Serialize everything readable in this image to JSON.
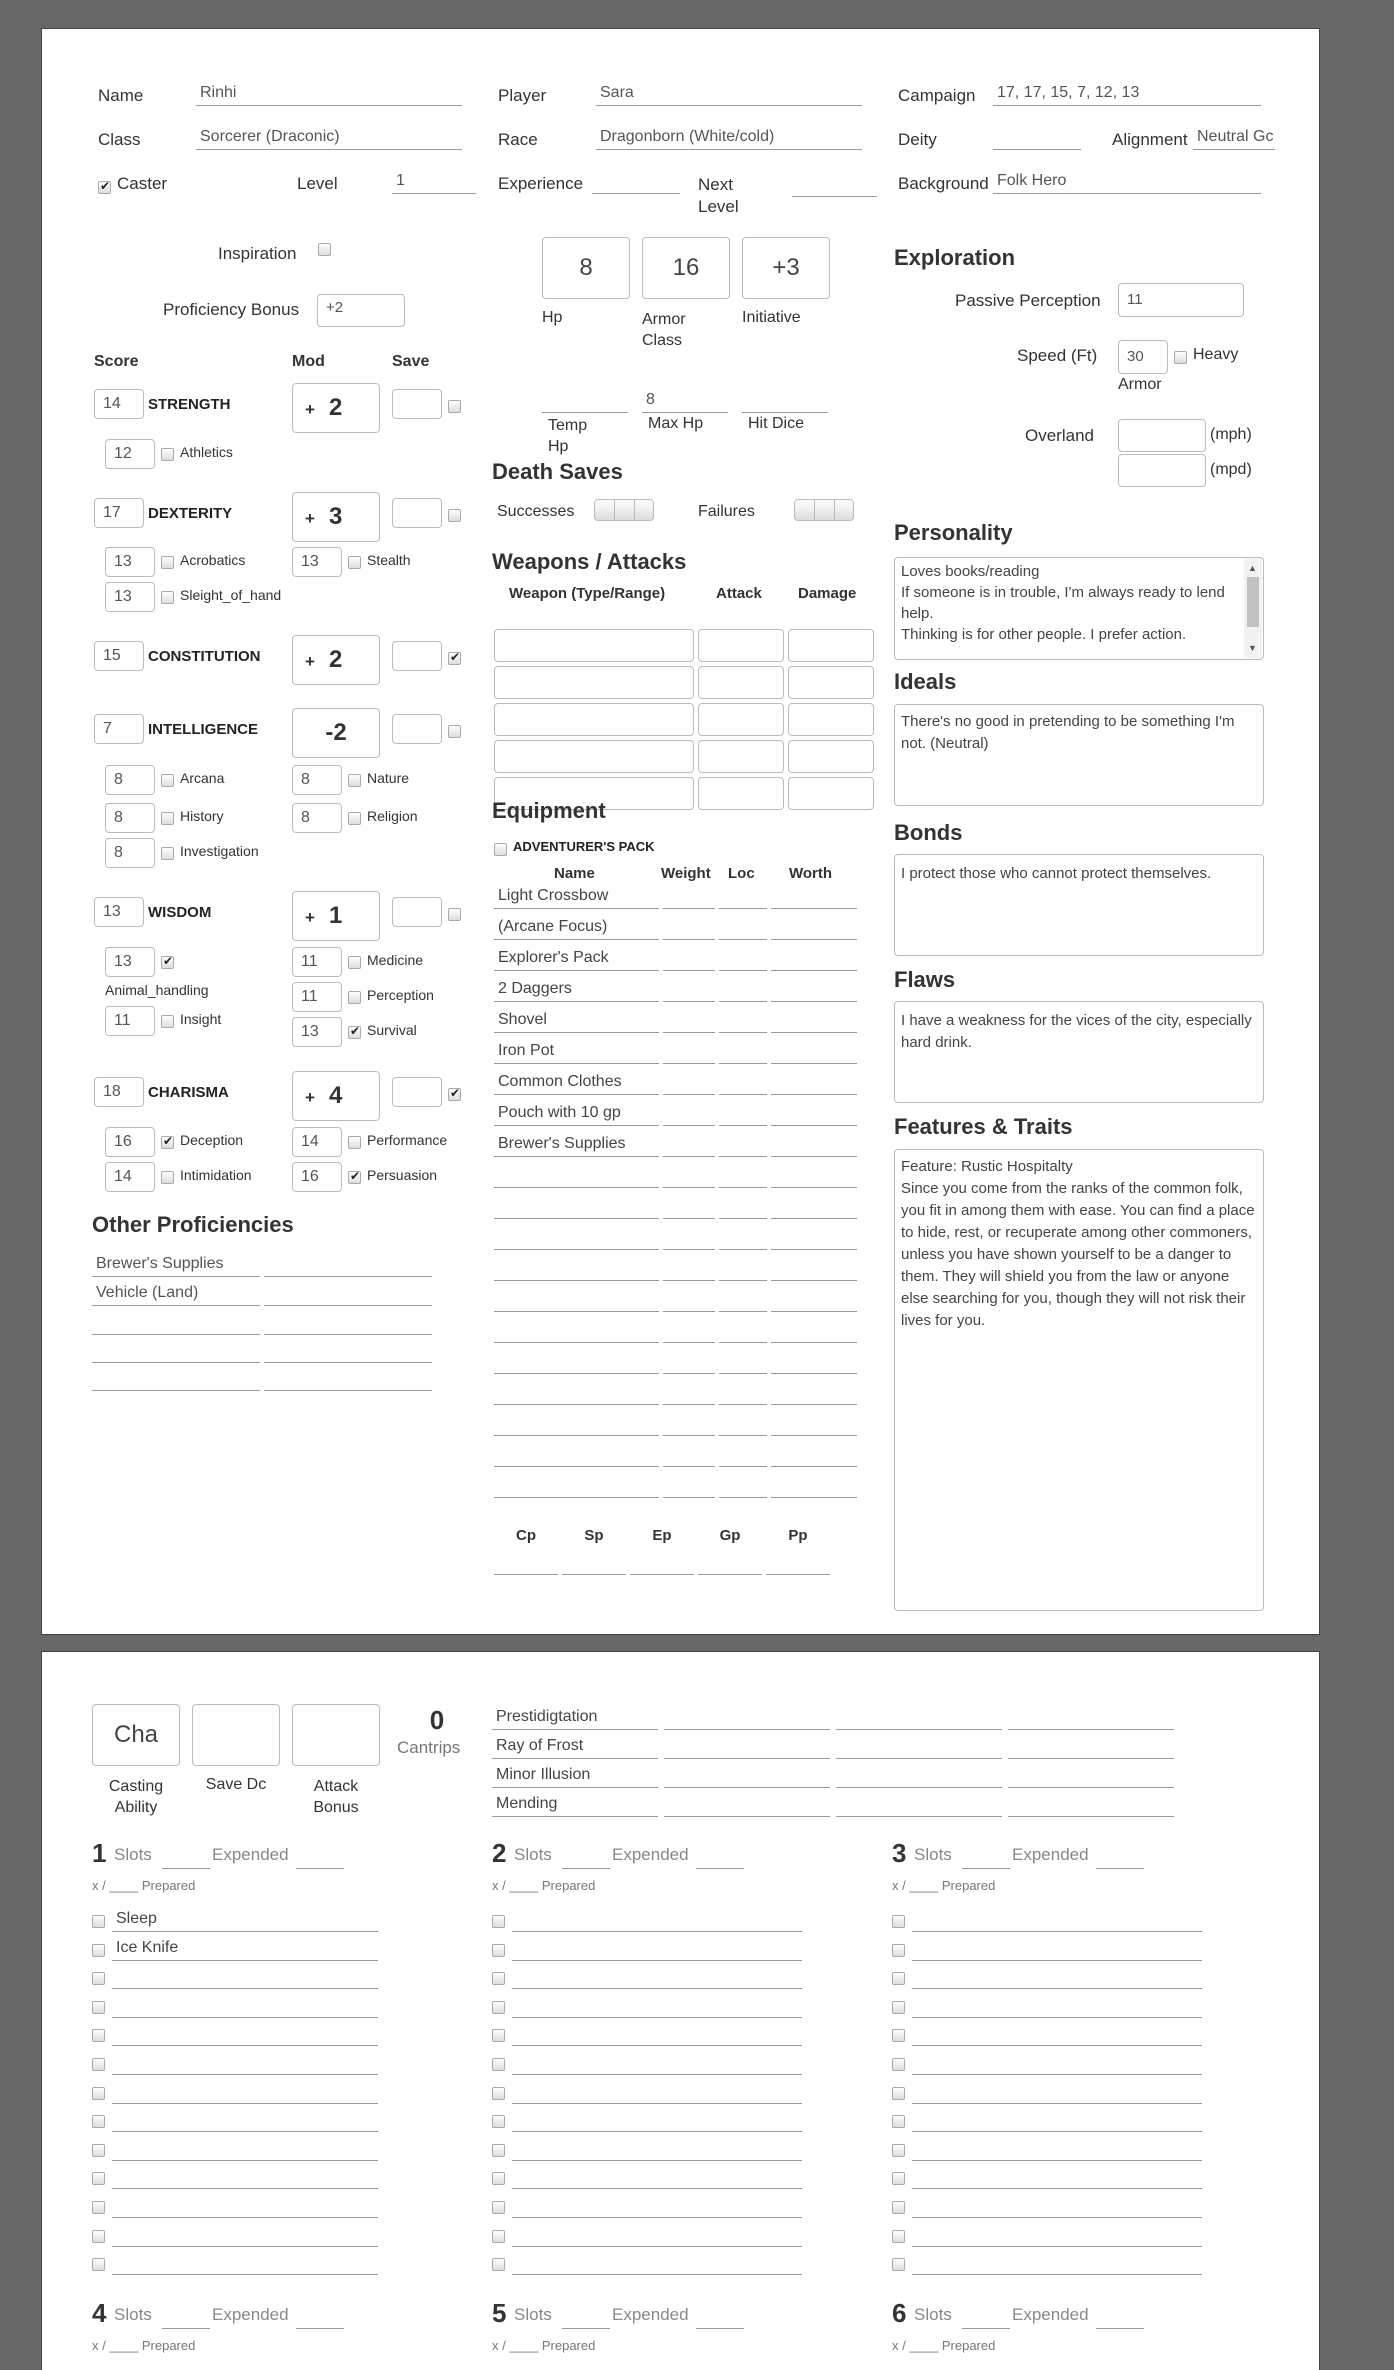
{
  "header": {
    "name_label": "Name",
    "name": "Rinhi",
    "player_label": "Player",
    "player": "Sara",
    "campaign_label": "Campaign",
    "campaign": "17, 17, 15, 7, 12, 13",
    "class_label": "Class",
    "class": "Sorcerer (Draconic)",
    "race_label": "Race",
    "race": "Dragonborn (White/cold)",
    "deity_label": "Deity",
    "deity": "",
    "alignment_label": "Alignment",
    "alignment": "Neutral Gc",
    "caster_label": "Caster",
    "level_label": "Level",
    "level": "1",
    "experience_label": "Experience",
    "next_level_label": "Next Level",
    "background_label": "Background",
    "background": "Folk Hero"
  },
  "left": {
    "inspiration_label": "Inspiration",
    "proficiency_label": "Proficiency Bonus",
    "proficiency": "+2",
    "score_hdr": "Score",
    "mod_hdr": "Mod",
    "save_hdr": "Save",
    "plus": "+",
    "str": {
      "score": "14",
      "name": "STRENGTH",
      "mod": "2"
    },
    "dex": {
      "score": "17",
      "name": "DEXTERITY",
      "mod": "3"
    },
    "con": {
      "score": "15",
      "name": "CONSTITUTION",
      "mod": "2"
    },
    "int": {
      "score": "7",
      "name": "INTELLIGENCE",
      "mod": "-2"
    },
    "wis": {
      "score": "13",
      "name": "WISDOM",
      "mod": "1"
    },
    "cha": {
      "score": "18",
      "name": "CHARISMA",
      "mod": "4"
    },
    "skills": {
      "athletics": {
        "v": "12",
        "l": "Athletics"
      },
      "acrobatics": {
        "v": "13",
        "l": "Acrobatics"
      },
      "stealth": {
        "v": "13",
        "l": "Stealth"
      },
      "sleight": {
        "v": "13",
        "l": "Sleight_of_hand"
      },
      "arcana": {
        "v": "8",
        "l": "Arcana"
      },
      "nature": {
        "v": "8",
        "l": "Nature"
      },
      "history": {
        "v": "8",
        "l": "History"
      },
      "religion": {
        "v": "8",
        "l": "Religion"
      },
      "investigation": {
        "v": "8",
        "l": "Investigation"
      },
      "animal": {
        "v": "13",
        "l": "Animal_handling"
      },
      "medicine": {
        "v": "11",
        "l": "Medicine"
      },
      "perception": {
        "v": "11",
        "l": "Perception"
      },
      "insight": {
        "v": "11",
        "l": "Insight"
      },
      "survival": {
        "v": "13",
        "l": "Survival"
      },
      "deception": {
        "v": "16",
        "l": "Deception"
      },
      "performance": {
        "v": "14",
        "l": "Performance"
      },
      "intimidation": {
        "v": "14",
        "l": "Intimidation"
      },
      "persuasion": {
        "v": "16",
        "l": "Persuasion"
      }
    },
    "other_prof_title": "Other Proficiencies",
    "other_prof": [
      "Brewer's Supplies",
      "Vehicle (Land)"
    ]
  },
  "mid": {
    "hp": "8",
    "hp_label": "Hp",
    "ac": "16",
    "ac_label": "Armor Class",
    "init": "+3",
    "init_label": "Initiative",
    "temp_hp_label": "Temp Hp",
    "max_hp": "8",
    "max_hp_label": "Max Hp",
    "hit_dice_label": "Hit Dice",
    "death_saves_title": "Death Saves",
    "successes_label": "Successes",
    "failures_label": "Failures",
    "weapons_title": "Weapons / Attacks",
    "weapon_hdr": "Weapon (Type/Range)",
    "attack_hdr": "Attack",
    "damage_hdr": "Damage",
    "equipment_title": "Equipment",
    "pack_label": "ADVENTURER'S PACK",
    "eq_name_hdr": "Name",
    "eq_weight_hdr": "Weight",
    "eq_loc_hdr": "Loc",
    "eq_worth_hdr": "Worth",
    "equipment": [
      "Light Crossbow",
      "(Arcane Focus)",
      "Explorer's Pack",
      "2 Daggers",
      "Shovel",
      "Iron Pot",
      "Common Clothes",
      "Pouch with 10 gp",
      "Brewer's Supplies"
    ],
    "coins": [
      "Cp",
      "Sp",
      "Ep",
      "Gp",
      "Pp"
    ]
  },
  "right": {
    "exploration_title": "Exploration",
    "passive_label": "Passive Perception",
    "passive": "11",
    "speed_label": "Speed (Ft)",
    "speed": "30",
    "heavy_label": "Heavy",
    "armor_label": "Armor",
    "overland_label": "Overland",
    "mph": "(mph)",
    "mpd": "(mpd)",
    "personality_title": "Personality",
    "personality": "Loves books/reading\nIf someone is in trouble, I'm always ready to lend help.\nThinking is for other people. I prefer action.",
    "ideals_title": "Ideals",
    "ideals": "There's no good in pretending to be something I'm not. (Neutral)",
    "bonds_title": "Bonds",
    "bonds": "I protect those who cannot protect themselves.",
    "flaws_title": "Flaws",
    "flaws": "I have a weakness for the vices of the city, especially hard drink.",
    "features_title": "Features & Traits",
    "features": "Feature: Rustic Hospitalty\nSince you come from the ranks of the common folk, you fit in among them with ease. You can find a place to hide, rest, or recuperate among other commoners, unless you have shown yourself to be a danger to them. They will shield you from the law or anyone else searching for you, though they will not risk their lives for you."
  },
  "spells": {
    "casting_ability": "Cha",
    "casting_ability_label": "Casting Ability",
    "save_dc": "",
    "save_dc_label": "Save Dc",
    "attack_bonus": "",
    "attack_bonus_label": "Attack Bonus",
    "cantrips_count": "0",
    "cantrips_label": "Cantrips",
    "cantrips": [
      "Prestidigtation",
      "Ray of Frost",
      "Minor Illusion",
      "Mending"
    ],
    "slots_label": "Slots",
    "expended_label": "Expended",
    "prepared_label": "x / ____ Prepared",
    "levels": [
      "1",
      "2",
      "3",
      "4",
      "5",
      "6"
    ],
    "level1": [
      "Sleep",
      "Ice Knife"
    ]
  }
}
